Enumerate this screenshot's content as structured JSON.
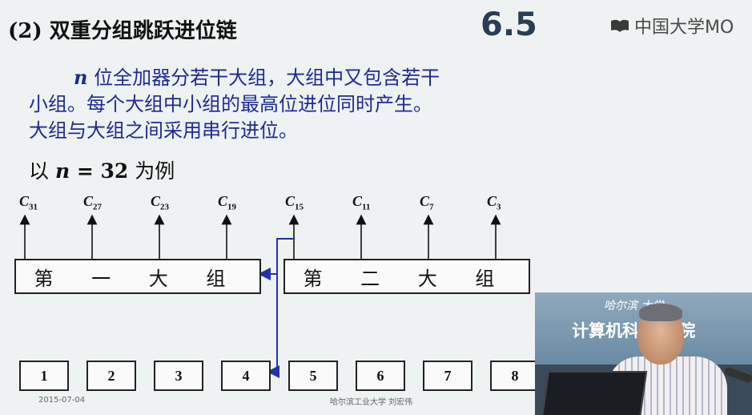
{
  "slide": {
    "title": "(2) 双重分组跳跃进位链",
    "section_number": "6.5",
    "brand": {
      "text": "中国大学MO",
      "icon": "mooc-logo-icon"
    },
    "paragraph": {
      "var": "n",
      "line1": " 位全加器分若干大组，大组中又包含若干",
      "line2": "小组。每个大组中小组的最高位进位同时产生。",
      "line3": "大组与大组之间采用串行进位。"
    },
    "example": {
      "prefix": "以 ",
      "expr": "n",
      "eq": " = 32",
      "suffix": " 为例"
    }
  },
  "diagram": {
    "carries": [
      {
        "c": "C",
        "sub": "31"
      },
      {
        "c": "C",
        "sub": "27"
      },
      {
        "c": "C",
        "sub": "23"
      },
      {
        "c": "C",
        "sub": "19"
      },
      {
        "c": "C",
        "sub": "15"
      },
      {
        "c": "C",
        "sub": "11"
      },
      {
        "c": "C",
        "sub": "7"
      },
      {
        "c": "C",
        "sub": "3"
      }
    ],
    "big_groups": [
      "第 一 大 组",
      "第 二 大 组"
    ],
    "small_groups": [
      "1",
      "2",
      "3",
      "4",
      "5",
      "6",
      "7",
      "8"
    ],
    "colors": {
      "wire": "#2233aa",
      "box_border": "#222222"
    }
  },
  "footer": {
    "date": "2015-07-04",
    "credit": "哈尔滨工业大学  刘宏伟"
  },
  "webcam": {
    "sign_line1": "哈尔滨  大学",
    "sign_line2": "计算机科    术学院"
  }
}
